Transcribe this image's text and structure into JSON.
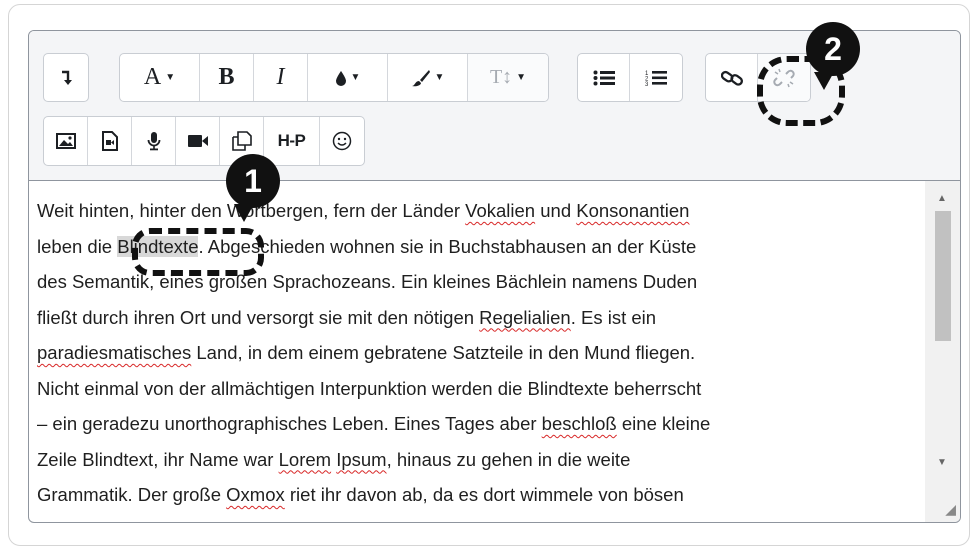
{
  "toolbar": {
    "row1": [
      {
        "name": "collapse-toggle-button",
        "icon": "arrow-down-turn-icon",
        "glyph": "↴"
      },
      {
        "name": "font-style-button",
        "label": "A",
        "dropdown": true
      },
      {
        "name": "bold-button",
        "label": "B"
      },
      {
        "name": "italic-button",
        "label": "I"
      },
      {
        "name": "text-color-button",
        "icon": "drop-icon",
        "glyph": "💧",
        "dropdown": true
      },
      {
        "name": "background-color-button",
        "icon": "brush-icon",
        "glyph": "🖌",
        "dropdown": true
      },
      {
        "name": "font-size-button",
        "label": "T↕",
        "dropdown": true
      },
      {
        "name": "bullet-list-button",
        "icon": "bullet-list-icon",
        "glyph": "☰"
      },
      {
        "name": "numbered-list-button",
        "icon": "numbered-list-icon",
        "glyph": "☷"
      },
      {
        "name": "link-button",
        "icon": "link-icon",
        "glyph": "🔗"
      },
      {
        "name": "unlink-button",
        "icon": "unlink-icon",
        "glyph": "⛓"
      }
    ],
    "row2": [
      {
        "name": "insert-image-button",
        "icon": "image-icon"
      },
      {
        "name": "insert-media-button",
        "icon": "media-file-icon"
      },
      {
        "name": "record-audio-button",
        "icon": "microphone-icon"
      },
      {
        "name": "record-video-button",
        "icon": "video-camera-icon"
      },
      {
        "name": "manage-files-button",
        "icon": "files-icon"
      },
      {
        "name": "h5p-button",
        "label": "H-P"
      },
      {
        "name": "emoji-button",
        "icon": "smiley-icon",
        "glyph": "☺"
      }
    ]
  },
  "content": {
    "lines": [
      [
        "Weit hinten, hinter den Wortbergen, fern der Länder ",
        {
          "spell": "Vokalien"
        },
        " und ",
        {
          "spell": "Konsonantien"
        }
      ],
      [
        "leben die ",
        {
          "highlight": "Blindtexte"
        },
        ". Abgeschieden wohnen sie in Buchstabhausen an der Küste"
      ],
      [
        "des Semantik, eines großen Sprachozeans. Ein kleines Bächlein namens Duden"
      ],
      [
        "fließt durch ihren Ort und versorgt sie mit den nötigen ",
        {
          "spell": "Regelialien"
        },
        ". Es ist ein"
      ],
      [
        {
          "spell": "paradiesmatisches"
        },
        " Land, in dem einem gebratene Satzteile in den Mund fliegen."
      ],
      [
        "Nicht einmal von der allmächtigen Interpunktion werden die Blindtexte beherrscht"
      ],
      [
        "– ein geradezu unorthographisches Leben. Eines Tages aber ",
        {
          "spell": "beschloß"
        },
        " eine kleine"
      ],
      [
        "Zeile Blindtext, ihr Name war ",
        {
          "spell": "Lorem"
        },
        " ",
        {
          "spell": "Ipsum"
        },
        ", hinaus zu gehen in die weite"
      ],
      [
        "Grammatik. Der große ",
        {
          "spell": "Oxmox"
        },
        " riet ihr davon ab, da es dort wimmele von bösen"
      ]
    ]
  },
  "callouts": [
    {
      "name": "callout-1",
      "label": "1"
    },
    {
      "name": "callout-2",
      "label": "2"
    }
  ]
}
